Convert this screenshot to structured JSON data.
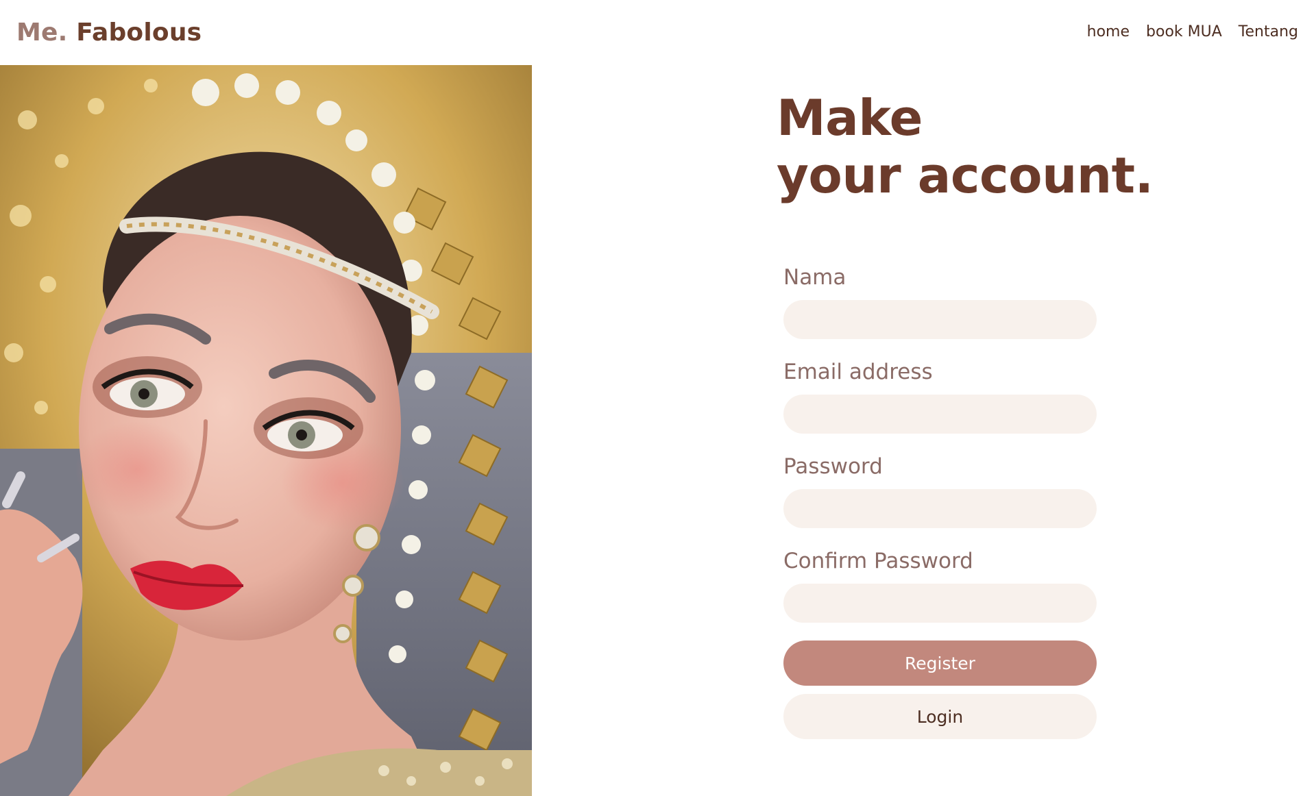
{
  "brand": {
    "prefix": "Me.",
    "name": "Fabolous"
  },
  "nav": {
    "items": [
      {
        "label": "home"
      },
      {
        "label": "book MUA"
      },
      {
        "label": "Tentang"
      }
    ]
  },
  "hero_image": {
    "description_icon": "bride-portrait-photo"
  },
  "form": {
    "heading_line1": "Make",
    "heading_line2": "your account.",
    "fields": [
      {
        "label": "Nama",
        "value": "",
        "placeholder": ""
      },
      {
        "label": "Email address",
        "value": "",
        "placeholder": ""
      },
      {
        "label": "Password",
        "value": "",
        "placeholder": ""
      },
      {
        "label": "Confirm Password",
        "value": "",
        "placeholder": ""
      }
    ],
    "register_label": "Register",
    "login_label": "Login"
  },
  "colors": {
    "brand_brown": "#6b3f2c",
    "brand_muted": "#9d7a71",
    "button_primary": "#c2887d",
    "input_bg": "#f8f1ec",
    "label_text": "#8a6b66"
  }
}
